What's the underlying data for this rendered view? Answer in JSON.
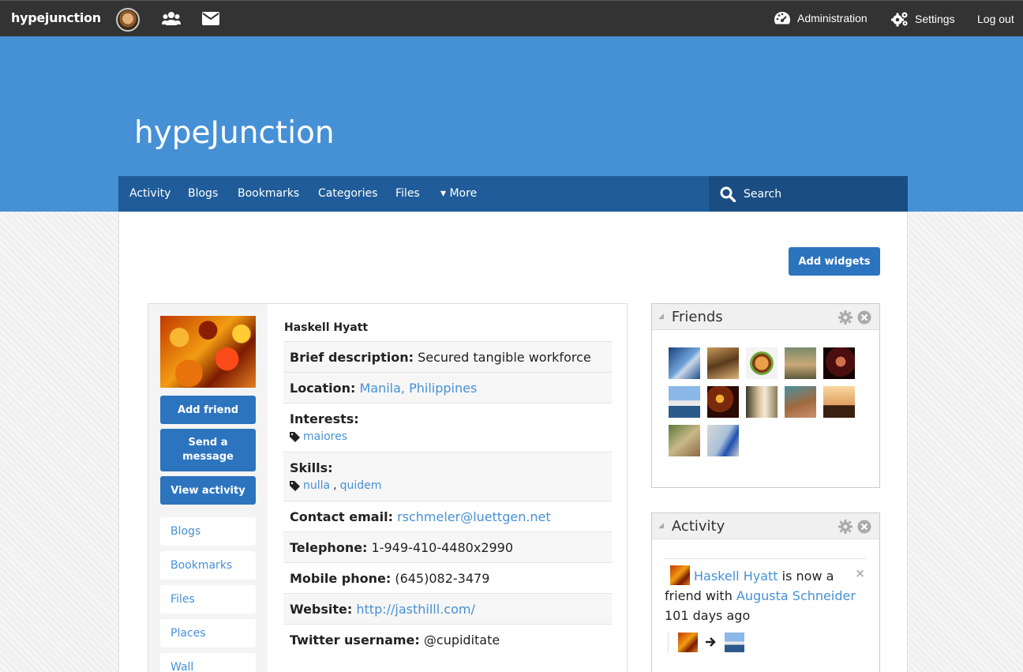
{
  "topbar": {
    "logo": "hypejunction",
    "admin_label": "Administration",
    "settings_label": "Settings",
    "logout_label": "Log out"
  },
  "header": {
    "site_title": "hypeJunction"
  },
  "nav": {
    "items": [
      "Activity",
      "Blogs",
      "Bookmarks",
      "Categories",
      "Files",
      "▾ More"
    ],
    "search_placeholder": "Search"
  },
  "main": {
    "add_widgets_label": "Add widgets"
  },
  "profile": {
    "name": "Haskell Hyatt",
    "buttons": [
      "Add friend",
      "Send a message",
      "View activity"
    ],
    "links": [
      "Blogs",
      "Bookmarks",
      "Files",
      "Places",
      "Wall"
    ],
    "fields": {
      "brief_label": "Brief description:",
      "brief_value": "Secured tangible workforce",
      "location_label": "Location:",
      "location_value": "Manila, Philippines",
      "interests_label": "Interests:",
      "interests": [
        "maiores"
      ],
      "skills_label": "Skills:",
      "skills": [
        "nulla",
        "quidem"
      ],
      "email_label": "Contact email:",
      "email_value": "rschmeler@luettgen.net",
      "telephone_label": "Telephone:",
      "telephone_value": "1-949-410-4480x2990",
      "mobile_label": "Mobile phone:",
      "mobile_value": "(645)082-3479",
      "website_label": "Website:",
      "website_value": "http://jasthilll.com/",
      "twitter_label": "Twitter username:",
      "twitter_value": "@cupiditate"
    }
  },
  "widgets": {
    "friends": {
      "title": "Friends",
      "count": 12
    },
    "activity": {
      "title": "Activity",
      "actor": "Haskell Hyatt",
      "verb": "is now a friend with",
      "target": "Augusta Schneider",
      "time": "101 days ago"
    }
  },
  "colors": {
    "topbar": "#333333",
    "header": "#4690d6",
    "nav": "#1f5c99",
    "button": "#2d74bf",
    "link": "#4690d6"
  }
}
